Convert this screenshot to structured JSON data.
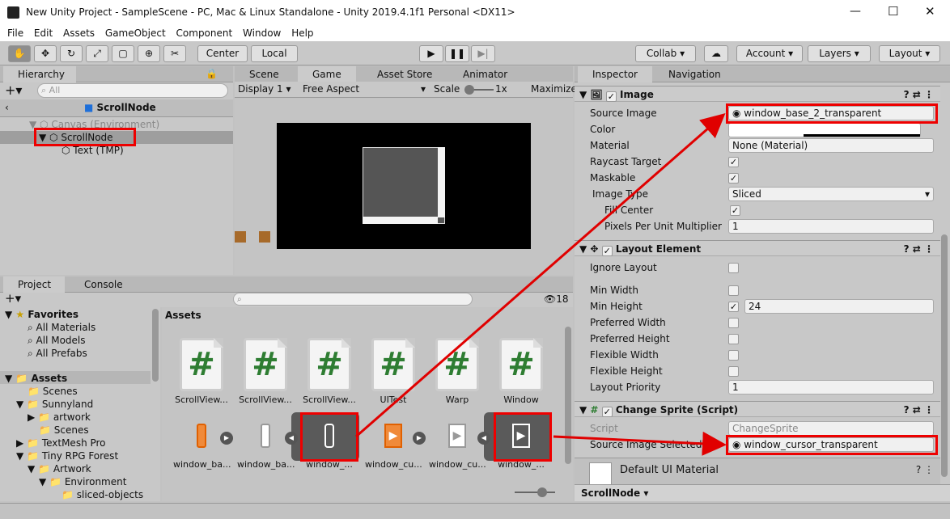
{
  "window": {
    "title": "New Unity Project - SampleScene - PC, Mac & Linux Standalone - Unity 2019.4.1f1 Personal <DX11>",
    "minimize": "—",
    "maximize": "☐",
    "close": "✕"
  },
  "menu": [
    "File",
    "Edit",
    "Assets",
    "GameObject",
    "Component",
    "Window",
    "Help"
  ],
  "toolbar": {
    "center": "Center",
    "local": "Local",
    "collab": "Collab ▾",
    "account": "Account",
    "layers": "Layers",
    "layout": "Layout"
  },
  "hierarchy": {
    "tab": "Hierarchy",
    "search_placeholder": "All",
    "scene_title": "ScrollNode",
    "items": [
      "Canvas (Environment)",
      "ScrollNode",
      "Text (TMP)"
    ]
  },
  "scene_tabs": {
    "scene": "Scene",
    "game": "Game",
    "asset_store": "Asset Store",
    "animator": "Animator"
  },
  "game_bar": {
    "display": "Display 1",
    "aspect": "Free Aspect",
    "scale_label": "Scale",
    "scale_value": "1x",
    "maximize": "Maximize"
  },
  "project": {
    "tab": "Project",
    "console": "Console",
    "count": "18",
    "tree": [
      "Favorites",
      "All Materials",
      "All Models",
      "All Prefabs",
      "Assets",
      "Scenes",
      "Sunnyland",
      "artwork",
      "Scenes",
      "TextMesh Pro",
      "Tiny RPG Forest",
      "Artwork",
      "Environment",
      "sliced-objects"
    ],
    "assets_header": "Assets",
    "scripts": [
      "ScrollView...",
      "ScrollView...",
      "ScrollView...",
      "UITest",
      "Warp",
      "Window"
    ],
    "sprites": [
      "window_ba...",
      "window_ba...",
      "window_...",
      "window_cu...",
      "window_cu...",
      "window_..."
    ]
  },
  "inspector": {
    "tab": "Inspector",
    "nav_tab": "Navigation",
    "image": {
      "header": "Image",
      "source_image_label": "Source Image",
      "source_image": "window_base_2_transparent",
      "color_label": "Color",
      "material_label": "Material",
      "material": "None (Material)",
      "raycast_label": "Raycast Target",
      "maskable_label": "Maskable",
      "image_type_label": "Image Type",
      "image_type": "Sliced",
      "fill_center_label": "Fill Center",
      "ppu_label": "Pixels Per Unit Multiplier",
      "ppu": "1"
    },
    "layout": {
      "header": "Layout Element",
      "ignore_label": "Ignore Layout",
      "min_width_label": "Min Width",
      "min_height_label": "Min Height",
      "min_height": "24",
      "pref_width_label": "Preferred Width",
      "pref_height_label": "Preferred Height",
      "flex_width_label": "Flexible Width",
      "flex_height_label": "Flexible Height",
      "priority_label": "Layout Priority",
      "priority": "1"
    },
    "change_sprite": {
      "header": "Change Sprite (Script)",
      "script_label": "Script",
      "script": "ChangeSprite",
      "selected_label": "Source Image Selected",
      "selected": "window_cursor_transparent"
    },
    "material_footer": "Default UI Material",
    "footer_object": "ScrollNode ▾"
  },
  "colors": {
    "highlight": "#e00000",
    "script_green": "#2e7d32"
  }
}
